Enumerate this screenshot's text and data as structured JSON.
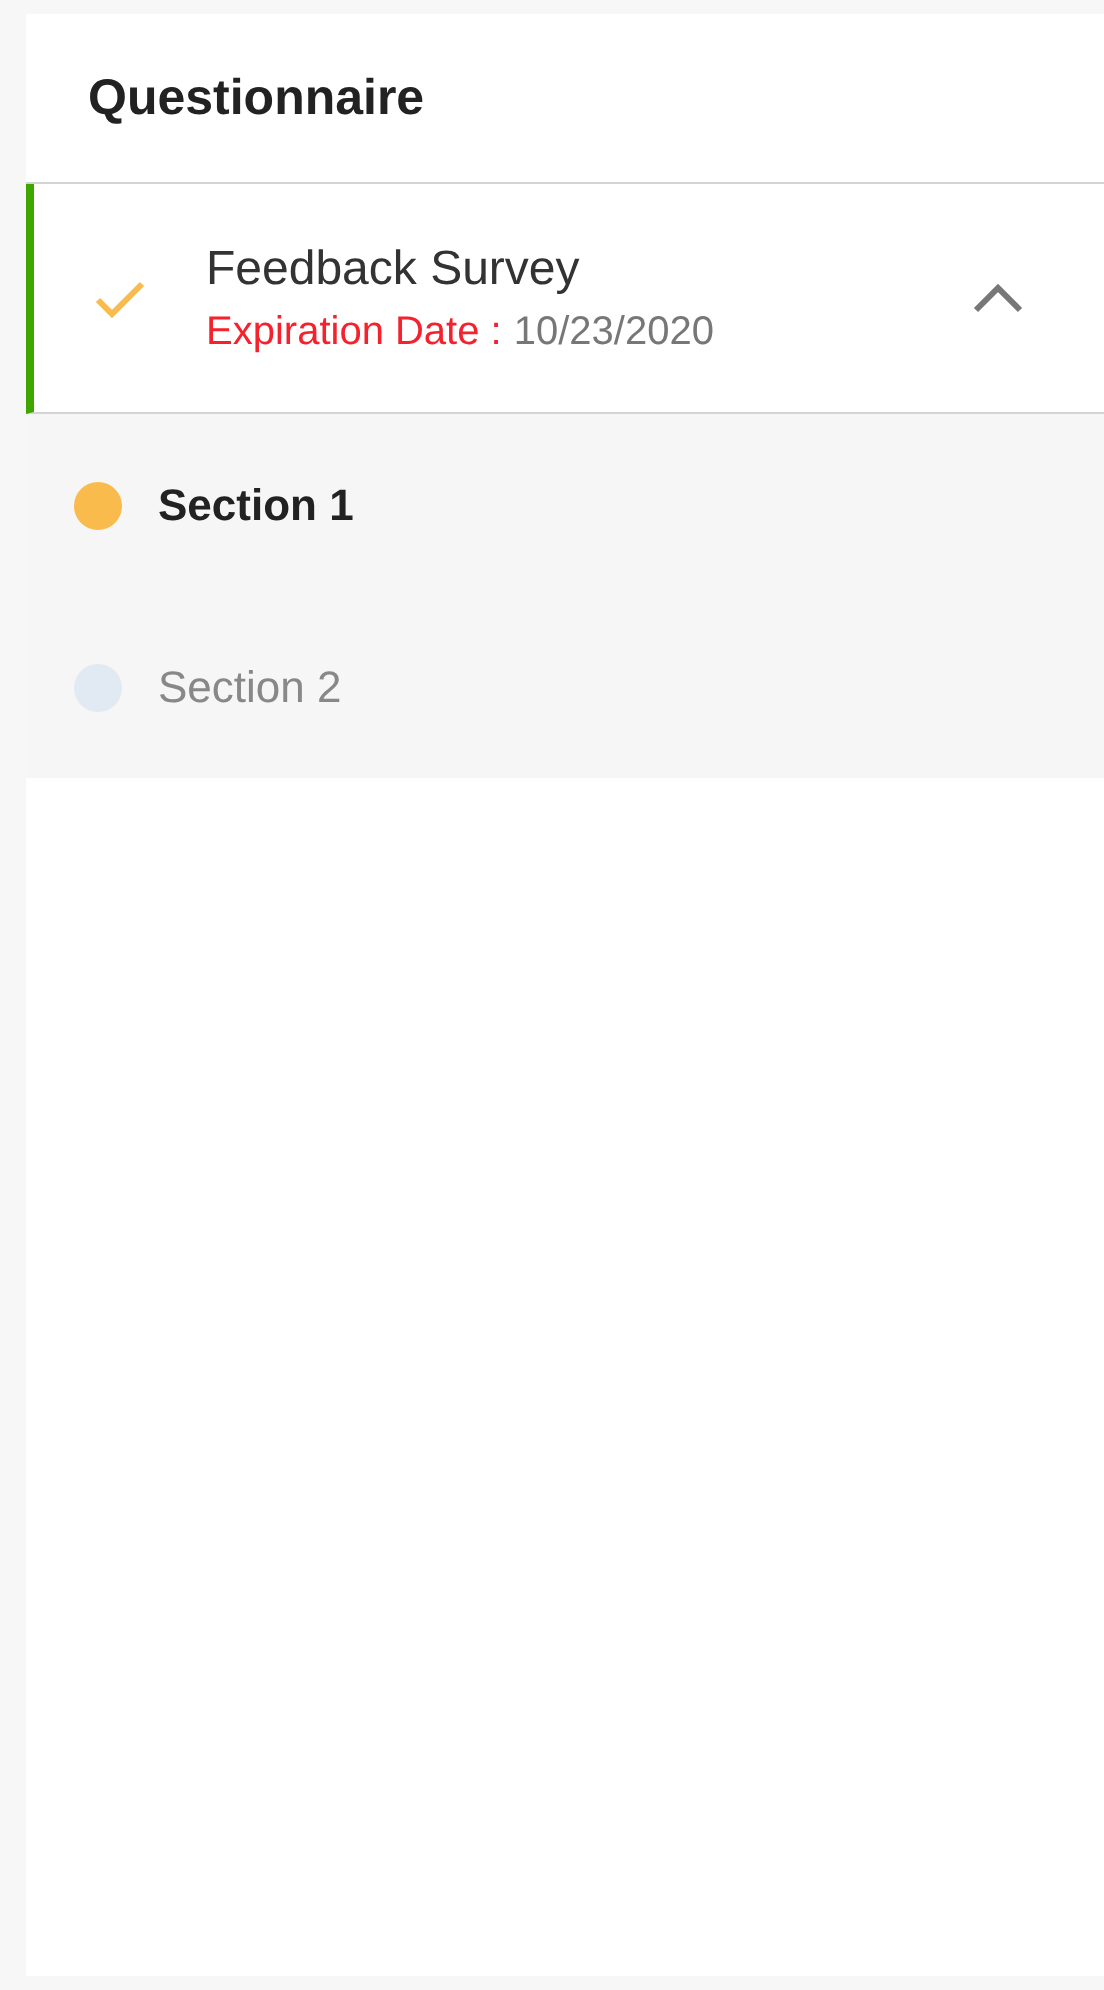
{
  "panel": {
    "title": "Questionnaire"
  },
  "survey": {
    "title": "Feedback Survey",
    "completed": true,
    "expanded": true,
    "expiration_label": "Expiration Date :",
    "expiration_value": "10/23/2020",
    "sections": [
      {
        "label": "Section 1",
        "selected": true,
        "color": "#f8bb4c"
      },
      {
        "label": "Section 2",
        "selected": false,
        "color": "#e1e9f2"
      }
    ]
  }
}
